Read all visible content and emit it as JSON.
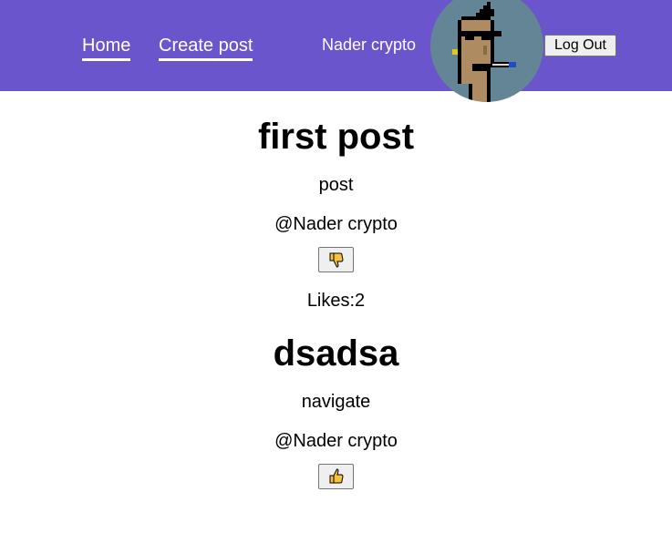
{
  "nav": {
    "home_label": "Home",
    "create_label": "Create post",
    "username": "Nader crypto",
    "logout_label": "Log Out"
  },
  "posts": [
    {
      "title": "first post",
      "content": "post",
      "author": "@Nader crypto",
      "like_icon": "thumbs-down-icon",
      "likes_label": "Likes:2"
    },
    {
      "title": "dsadsa",
      "content": "navigate",
      "author": "@Nader crypto",
      "like_icon": "thumbs-up-icon"
    }
  ],
  "colors": {
    "navbar": "#6a55cc",
    "avatar_background": "#648596",
    "thumb": "#f6c13b"
  }
}
